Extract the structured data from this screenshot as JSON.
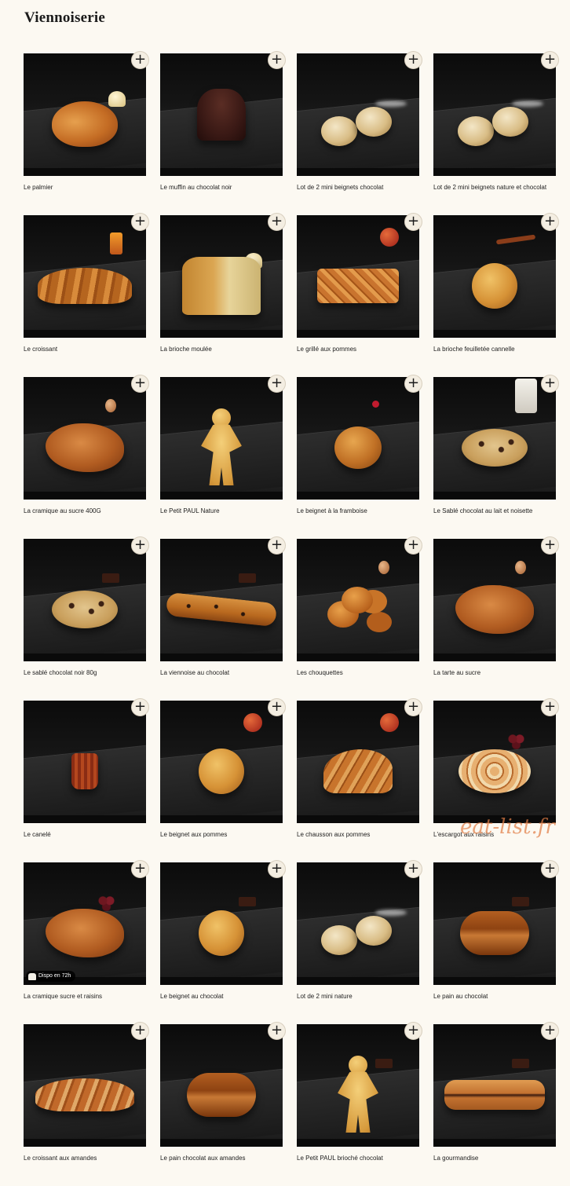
{
  "section": {
    "title": "Viennoiserie"
  },
  "products": [
    {
      "name": "Le palmier",
      "shape": "palmier",
      "props": [
        "cream"
      ]
    },
    {
      "name": "Le muffin au chocolat noir",
      "shape": "muffin",
      "props": []
    },
    {
      "name": "Lot de 2 mini beignets chocolat",
      "shape": "beignet2",
      "props": [
        "sugar"
      ]
    },
    {
      "name": "Lot de 2 mini beignets nature et chocolat",
      "shape": "beignet2",
      "props": [
        "sugar"
      ]
    },
    {
      "name": "Le croissant",
      "shape": "croissant",
      "props": [
        "jar"
      ]
    },
    {
      "name": "La brioche moulée",
      "shape": "loaf",
      "props": [
        "cream"
      ]
    },
    {
      "name": "Le grillé aux pommes",
      "shape": "rect",
      "props": [
        "apple"
      ]
    },
    {
      "name": "La brioche feuilletée cannelle",
      "shape": "bun",
      "props": [
        "cinnamon"
      ]
    },
    {
      "name": "La cramique au sucre 400G",
      "shape": "flat",
      "props": [
        "egg"
      ]
    },
    {
      "name": "Le Petit PAUL Nature",
      "shape": "man",
      "props": []
    },
    {
      "name": "Le beignet à la framboise",
      "shape": "bun-dark",
      "props": [
        "berry"
      ]
    },
    {
      "name": "Le Sablé chocolat au lait et noisette",
      "shape": "cookie",
      "props": [
        "glass"
      ]
    },
    {
      "name": "Le sablé chocolat noir 80g",
      "shape": "cookie",
      "props": [
        "choc"
      ]
    },
    {
      "name": "La viennoise au chocolat",
      "shape": "baguette",
      "props": [
        "choc"
      ]
    },
    {
      "name": "Les chouquettes",
      "shape": "puffs",
      "props": [
        "egg"
      ]
    },
    {
      "name": "La tarte au sucre",
      "shape": "flat",
      "props": [
        "egg"
      ]
    },
    {
      "name": "Le canelé",
      "shape": "caneles",
      "props": []
    },
    {
      "name": "Le beignet aux pommes",
      "shape": "bun",
      "props": [
        "apple"
      ]
    },
    {
      "name": "Le chausson aux pommes",
      "shape": "chausson",
      "props": [
        "apple"
      ]
    },
    {
      "name": "L'escargot aux raisins",
      "shape": "swirl",
      "props": [
        "grape"
      ]
    },
    {
      "name": "La cramique sucre et raisins",
      "shape": "flat",
      "props": [
        "grape"
      ],
      "badge": "Dispo en 72h"
    },
    {
      "name": "Le beignet au chocolat",
      "shape": "bun",
      "props": [
        "choc"
      ]
    },
    {
      "name": "Lot de 2 mini nature",
      "shape": "beignet2",
      "props": [
        "sugar"
      ]
    },
    {
      "name": "Le pain au chocolat",
      "shape": "painchoc",
      "props": [
        "choc"
      ]
    },
    {
      "name": "Le croissant aux amandes",
      "shape": "amande",
      "props": []
    },
    {
      "name": "Le pain chocolat aux amandes",
      "shape": "painchoc",
      "props": []
    },
    {
      "name": "Le Petit PAUL brioché chocolat",
      "shape": "man",
      "props": [
        "choc"
      ]
    },
    {
      "name": "La gourmandise",
      "shape": "gourmandise",
      "props": [
        "choc"
      ]
    }
  ],
  "add_button": {
    "label": "+",
    "icon": "plus-icon"
  },
  "watermark": "eat-list.fr",
  "colors": {
    "background": "#fcf9f2",
    "photo_bg": "#101010",
    "text": "#1d1d1d"
  }
}
